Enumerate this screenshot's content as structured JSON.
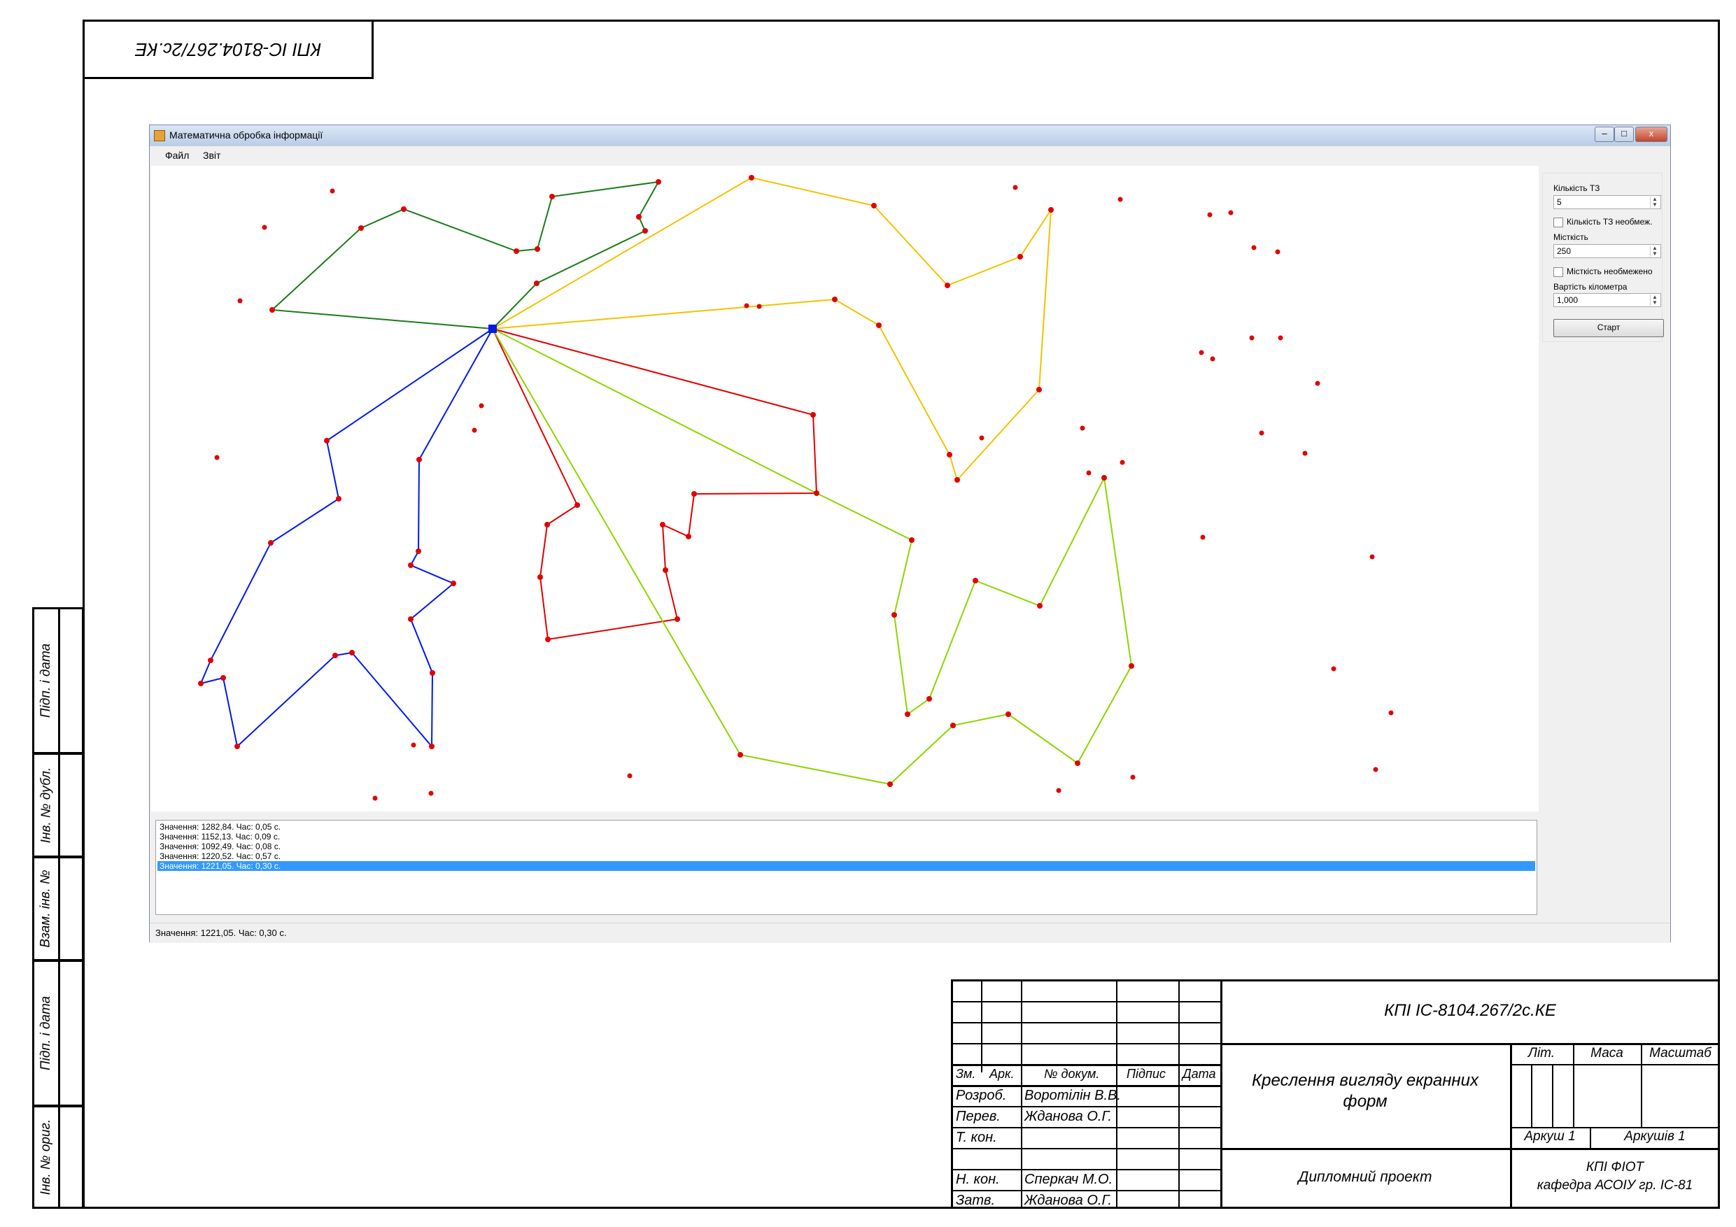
{
  "drawing_frame": {
    "code_rotated": "КПІ ІС-8104.267/2с.КЕ",
    "side_stamps": [
      "Підп. і дата",
      "Інв. № дубл.",
      "Взам. інв. №",
      "Підп. і дата",
      "Інв. № ориг."
    ]
  },
  "window": {
    "title": "Математична обробка інформації",
    "menu": [
      "Файл",
      "Звіт"
    ],
    "controls": {
      "minimize": "–",
      "maximize": "□",
      "close": "x"
    }
  },
  "panel": {
    "vehicles_label": "Кількість ТЗ",
    "vehicles_value": "5",
    "vehicles_unlimited_label": "Кількість ТЗ необмеж.",
    "capacity_label": "Місткість",
    "capacity_value": "250",
    "capacity_unlimited_label": "Місткість необмежено",
    "km_cost_label": "Вартість кілометра",
    "km_cost_value": "1,000",
    "start_label": "Старт"
  },
  "log": [
    "Значення: 1282,84. Час: 0,05 с.",
    "Значення: 1152,13. Час: 0,09 с.",
    "Значення: 1092,49. Час: 0,08 с.",
    "Значення: 1220,52. Час: 0,57 с.",
    "Значення: 1221,05. Час: 0,30 с."
  ],
  "log_selected_index": 4,
  "status_text": "Значення: 1221,05. Час: 0,30 с.",
  "route_colors": {
    "green": "#1a7a1a",
    "yellow": "#f2c200",
    "red": "#e00000",
    "lime": "#8fd400",
    "blue": "#0018e8",
    "points": "#e00000",
    "depot": "#0018e8",
    "selection": "#3399ff"
  },
  "title_block": {
    "code": "КПІ ІС-8104.267/2с.КЕ",
    "headers": [
      "Зм.",
      "Арк.",
      "№ докум.",
      "Підпис",
      "Дата"
    ],
    "roles": [
      {
        "role": "Розроб.",
        "name": "Воротілін В.В."
      },
      {
        "role": "Перев.",
        "name": "Жданова О.Г."
      },
      {
        "role": "Т. кон.",
        "name": ""
      },
      {
        "role": "",
        "name": ""
      },
      {
        "role": "Н. кон.",
        "name": "Сперкач М.О."
      },
      {
        "role": "Затв.",
        "name": "Жданова О.Г."
      }
    ],
    "drawing_title_line1": "Креслення вигляду екранних",
    "drawing_title_line2": "форм",
    "lit": "Літ.",
    "mass": "Маса",
    "scale": "Масштаб",
    "sheet": "Аркуш 1",
    "sheets": "Аркушів 1",
    "project": "Дипломний проект",
    "org_line1": "КПІ ФІОТ",
    "org_line2": "кафедра АСОІУ гр. ІС-81"
  }
}
